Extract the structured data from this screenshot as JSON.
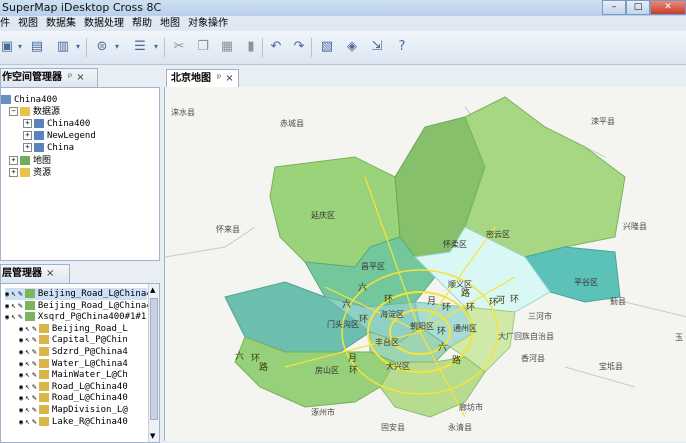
{
  "window": {
    "title": "SuperMap iDesktop Cross 8C"
  },
  "menu": [
    "件",
    "视图",
    "数据集",
    "数据处理",
    "帮助",
    "地图",
    "对象操作"
  ],
  "toolbar_icons": [
    "open-icon",
    "save-icon",
    "new-workspace-icon",
    "import-icon",
    "datasource-icon",
    "cut-icon",
    "copy-icon",
    "paste-icon",
    "delete-icon",
    "undo-icon",
    "redo-icon",
    "layout-icon",
    "scene-icon",
    "export-icon",
    "help-icon"
  ],
  "workspace_panel": {
    "title": "作空间管理器",
    "pin": "ᵖ",
    "close": "×",
    "root": "China400",
    "datasource_label": "数据源",
    "datasources": [
      "China400",
      "NewLegend",
      "China"
    ],
    "maps": "地图",
    "resources": "资源"
  },
  "layer_panel": {
    "title": "层管理器",
    "close": "×",
    "layers": [
      {
        "name": "Beijing_Road_L@China400",
        "sel": true
      },
      {
        "name": "Beijing_Road_L@China400",
        "sel": false
      },
      {
        "name": "Xsqrd_P@China400#1#1",
        "sel": false
      },
      {
        "name": "Beijing_Road_L",
        "sel": false
      },
      {
        "name": "Capital_P@Chin",
        "sel": false
      },
      {
        "name": "Sdzrd_P@China4",
        "sel": false
      },
      {
        "name": "Water_L@China4",
        "sel": false
      },
      {
        "name": "MainWater_L@Ch",
        "sel": false
      },
      {
        "name": "Road_L@China40",
        "sel": false
      },
      {
        "name": "Road_L@China40",
        "sel": false
      },
      {
        "name": "MapDivision_L@",
        "sel": false
      },
      {
        "name": "Lake_R@China40",
        "sel": false
      }
    ]
  },
  "map_tab": {
    "title": "北京地图",
    "pin": "ᵖ",
    "close": "×"
  },
  "map_labels": {
    "outer": [
      "涞水县",
      "赤城县",
      "滦平县",
      "兴隆县",
      "怀来县",
      "蓟县",
      "三河市",
      "大厂回族自治县",
      "香河县",
      "宝坻县",
      "玉",
      "涿州市",
      "廊坊市",
      "固安县",
      "永清县"
    ],
    "districts": [
      "延庆区",
      "怀柔区",
      "密云区",
      "平谷区",
      "昌平区",
      "顺义区",
      "海淀区",
      "门头沟区",
      "朝阳区",
      "通州区",
      "丰台区",
      "房山区",
      "大兴区"
    ],
    "road_labels": [
      "六",
      "环",
      "六",
      "环",
      "月",
      "环",
      "环",
      "环",
      "路",
      "六",
      "环",
      "六",
      "环",
      "路",
      "月",
      "环",
      "路",
      "环",
      "河"
    ]
  },
  "colors": {
    "accent": "#3b6ea5",
    "district_green": "#9bd37b",
    "district_teal": "#5cc2b7",
    "district_cyan": "#d9f7f4",
    "road_yellow": "#f4e43a"
  }
}
